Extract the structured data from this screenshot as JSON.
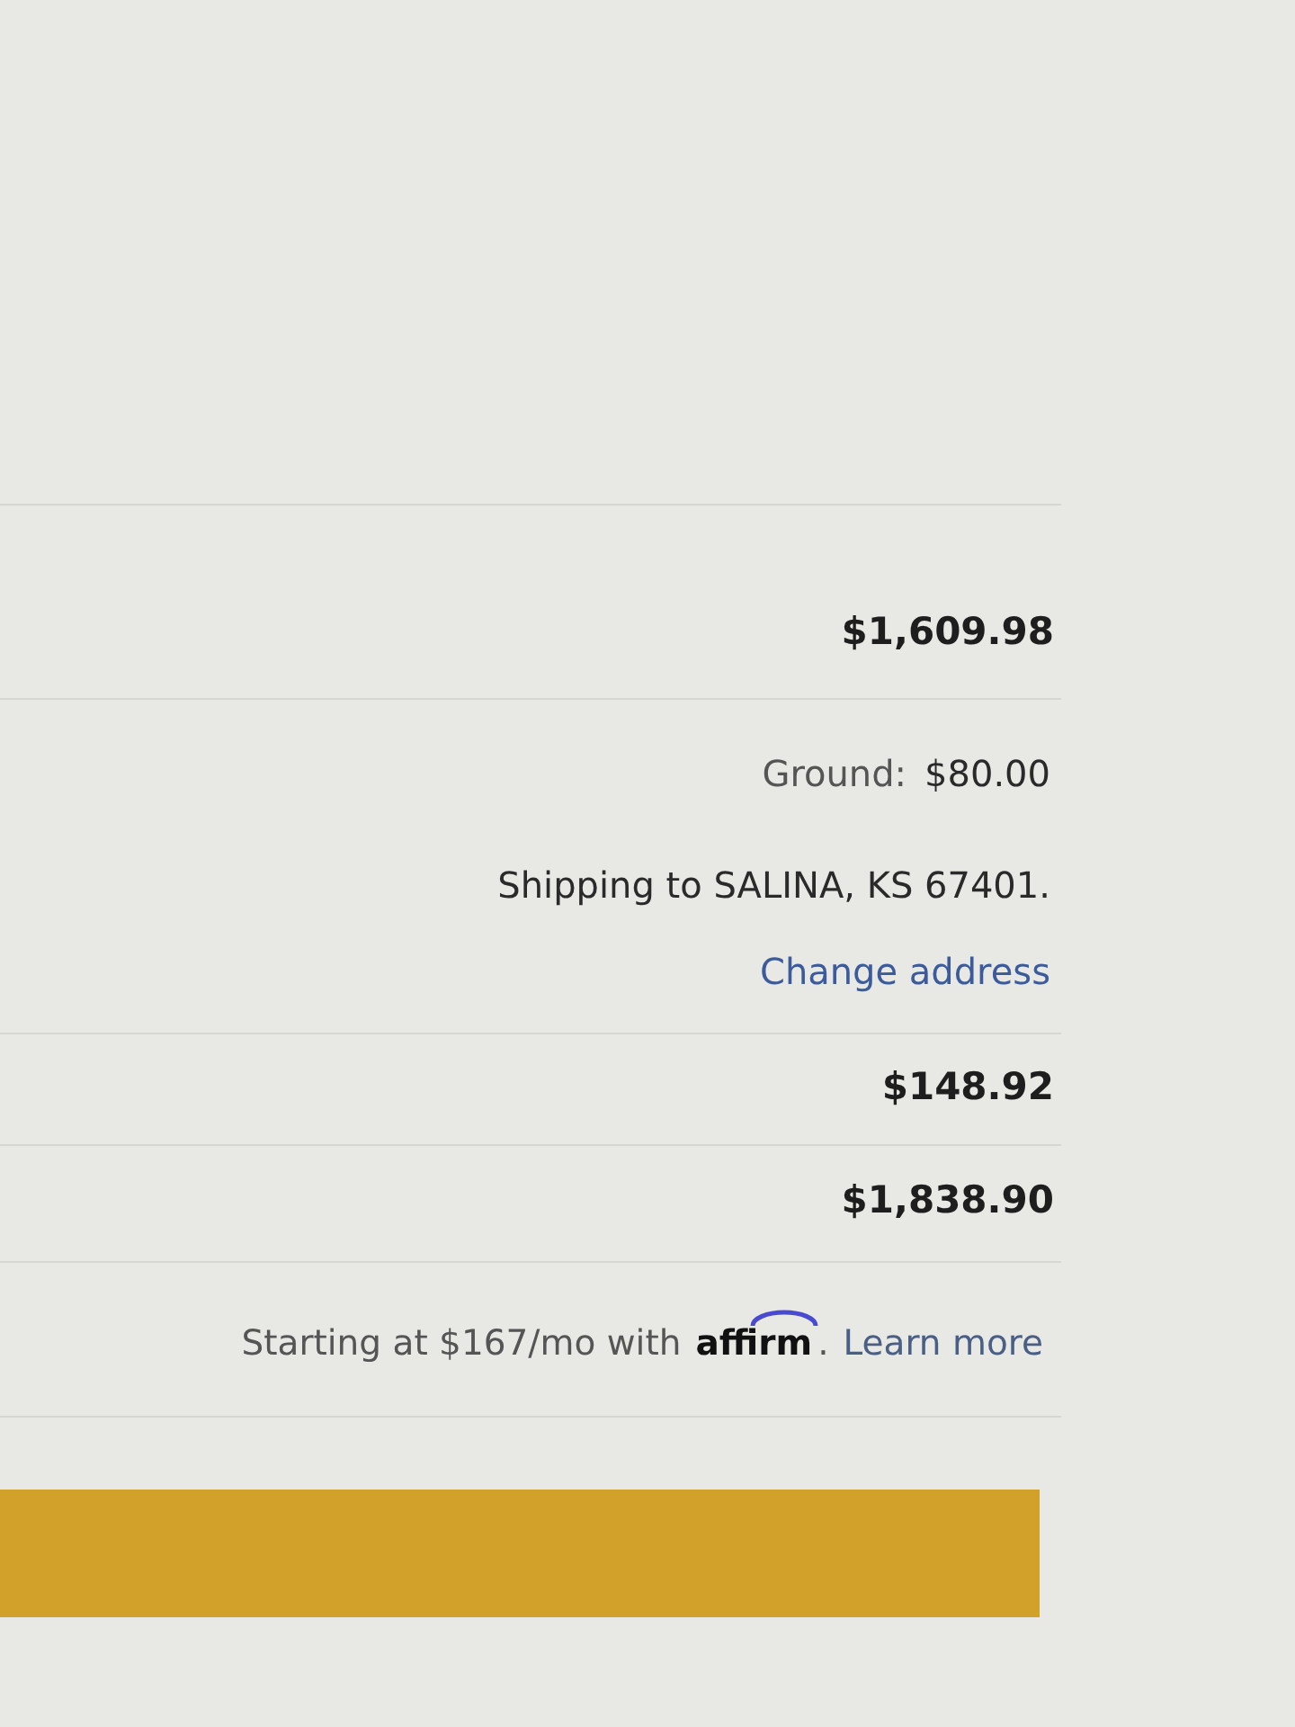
{
  "summary": {
    "rows": [
      {
        "kind": "amount",
        "value": "$1,609.98"
      },
      {
        "kind": "shipping",
        "method": "Ground:",
        "cost": "$80.00",
        "destination": "Shipping to SALINA, KS 67401.",
        "link": "Change address"
      },
      {
        "kind": "amount",
        "value": "$148.92"
      },
      {
        "kind": "amount",
        "value": "$1,838.90"
      }
    ]
  },
  "financing": {
    "text": "Starting at $167/mo with",
    "brand": "affirm",
    "brand_suffix": ".",
    "link": "Learn more"
  }
}
